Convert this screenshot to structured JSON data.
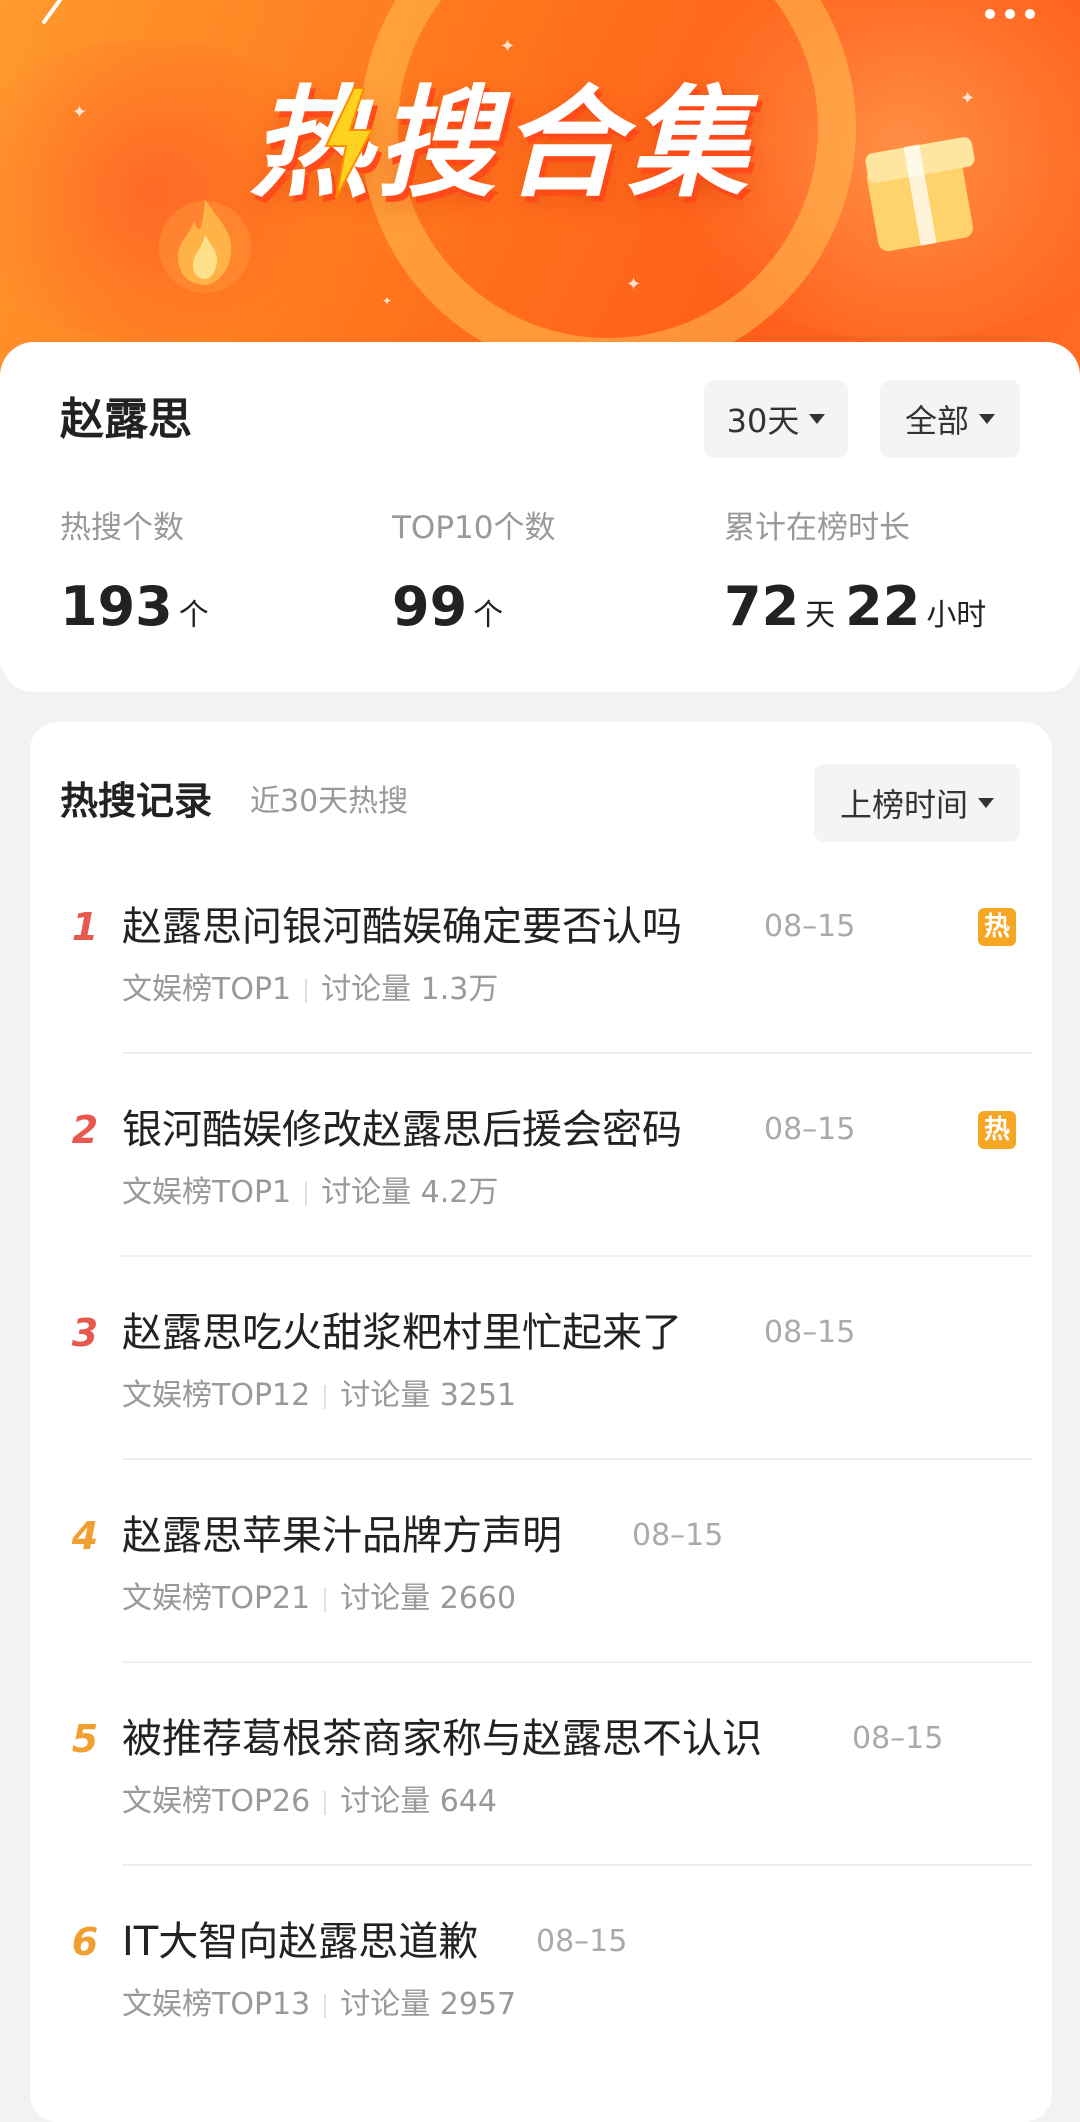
{
  "banner": {
    "title": "热搜合集"
  },
  "profile": {
    "name": "赵露思",
    "period_filter": "30天",
    "type_filter": "全部"
  },
  "stats": [
    {
      "label": "热搜个数",
      "value": "193",
      "unit": "个"
    },
    {
      "label": "TOP10个数",
      "value": "99",
      "unit": "个"
    },
    {
      "label": "累计在榜时长",
      "days": "72",
      "days_unit": "天",
      "hours": "22",
      "hours_unit": "小时"
    }
  ],
  "records": {
    "title": "热搜记录",
    "subtitle": "近30天热搜",
    "sort_label": "上榜时间",
    "items": [
      {
        "rank": "1",
        "title": "赵露思问银河酷娱确定要否认吗",
        "date": "08–15",
        "board": "文娱榜TOP1",
        "discussion": "讨论量 1.3万",
        "hot_badge": "热"
      },
      {
        "rank": "2",
        "title": "银河酷娱修改赵露思后援会密码",
        "date": "08–15",
        "board": "文娱榜TOP1",
        "discussion": "讨论量 4.2万",
        "hot_badge": "热"
      },
      {
        "rank": "3",
        "title": "赵露思吃火甜浆粑村里忙起来了",
        "date": "08–15",
        "board": "文娱榜TOP12",
        "discussion": "讨论量 3251",
        "hot_badge": ""
      },
      {
        "rank": "4",
        "title": "赵露思苹果汁品牌方声明",
        "date": "08–15",
        "board": "文娱榜TOP21",
        "discussion": "讨论量 2660",
        "hot_badge": ""
      },
      {
        "rank": "5",
        "title": "被推荐葛根茶商家称与赵露思不认识",
        "date": "08–15",
        "board": "文娱榜TOP26",
        "discussion": "讨论量 644",
        "hot_badge": ""
      },
      {
        "rank": "6",
        "title": "IT大智向赵露思道歉",
        "date": "08–15",
        "board": "文娱榜TOP13",
        "discussion": "讨论量 2957",
        "hot_badge": ""
      }
    ]
  },
  "colors": {
    "rank_top3": "#e8584f",
    "rank_other": "#f0a030",
    "hot_badge": "#f5a623",
    "banner_orange": "#ff7a1e"
  },
  "icons": [
    "back-chevron-icon",
    "more-dots-icon",
    "dropdown-triangle-icon",
    "flame-icon",
    "lightning-bolt-icon",
    "gift-box-icon"
  ]
}
